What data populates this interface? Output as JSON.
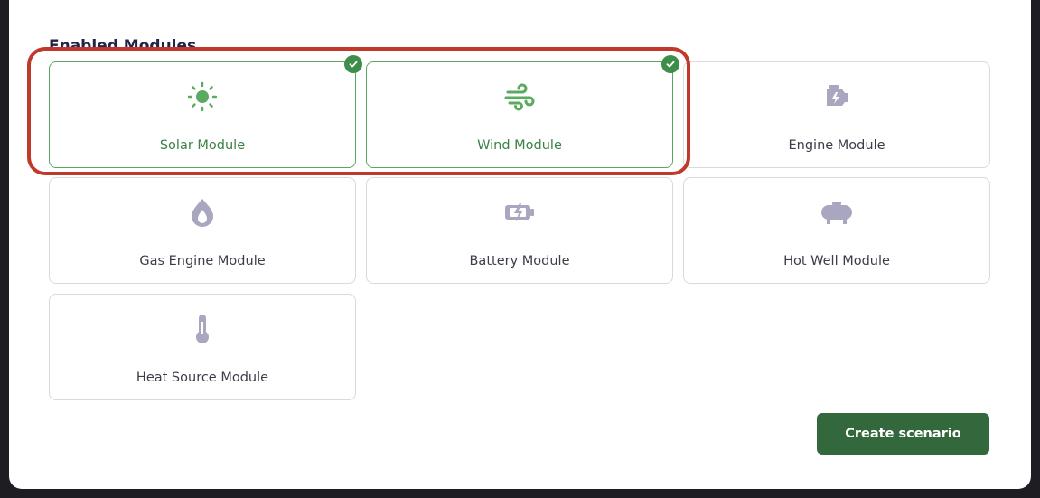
{
  "section_title": "Enabled Modules",
  "modules": [
    {
      "label": "Solar Module",
      "icon": "sun-icon",
      "selected": true
    },
    {
      "label": "Wind Module",
      "icon": "wind-icon",
      "selected": true
    },
    {
      "label": "Engine Module",
      "icon": "engine-icon",
      "selected": false
    },
    {
      "label": "Gas Engine Module",
      "icon": "flame-icon",
      "selected": false
    },
    {
      "label": "Battery Module",
      "icon": "battery-bolt-icon",
      "selected": false
    },
    {
      "label": "Hot Well Module",
      "icon": "tank-icon",
      "selected": false
    },
    {
      "label": "Heat Source Module",
      "icon": "thermometer-icon",
      "selected": false
    }
  ],
  "create_button_label": "Create scenario",
  "colors": {
    "accent_green": "#3f8d4b",
    "selected_border": "#5aa564",
    "icon_inactive": "#a9a6c0",
    "button_bg": "#33683c",
    "highlight_red": "#c0392b"
  }
}
